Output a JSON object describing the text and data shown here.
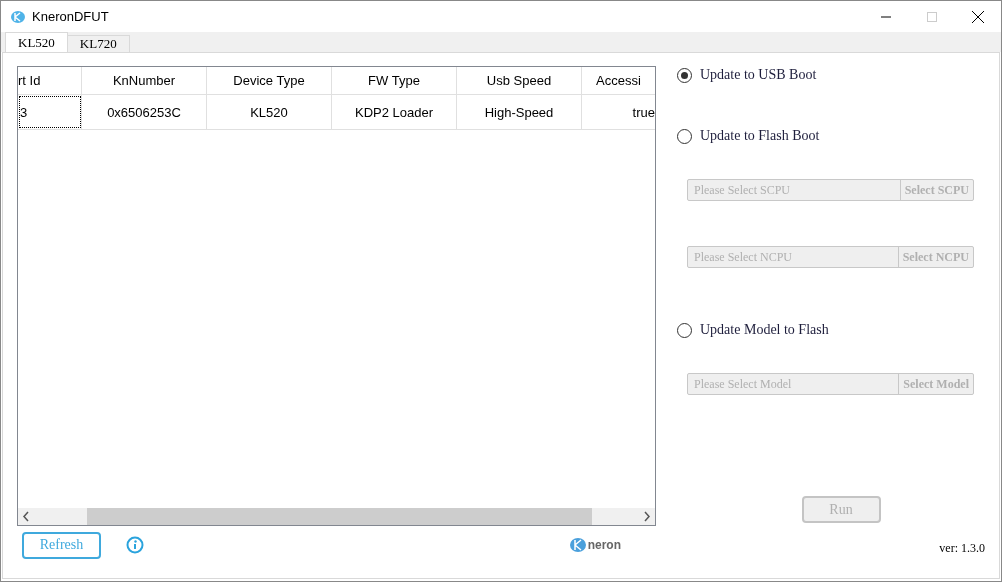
{
  "window": {
    "title": "KneronDFUT"
  },
  "tabs": [
    {
      "label": "KL520",
      "selected": true
    },
    {
      "label": "KL720",
      "selected": false
    }
  ],
  "table": {
    "columns": [
      "rt Id",
      "KnNumber",
      "Device Type",
      "FW Type",
      "Usb Speed",
      "Accessi"
    ],
    "rows": [
      {
        "cells": [
          {
            "text": "3",
            "focused": true
          },
          {
            "text": "0x6506253C",
            "focused": false
          },
          {
            "text": "KL520",
            "focused": false
          },
          {
            "text": "KDP2 Loader",
            "focused": false
          },
          {
            "text": "High-Speed",
            "focused": false
          },
          {
            "text": "true",
            "focused": false
          }
        ]
      }
    ]
  },
  "refresh_button": "Refresh",
  "logo_text": "neron",
  "options": [
    {
      "label": "Update to USB Boot",
      "selected": true
    },
    {
      "label": "Update to Flash Boot",
      "selected": false,
      "pickers": [
        {
          "placeholder": "Please Select SCPU",
          "button": "Select SCPU",
          "disabled": true
        },
        {
          "placeholder": "Please Select NCPU",
          "button": "Select NCPU",
          "disabled": true
        }
      ]
    },
    {
      "label": "Update Model to Flash",
      "selected": false,
      "pickers": [
        {
          "placeholder": "Please Select Model",
          "button": "Select Model",
          "disabled": true
        }
      ]
    }
  ],
  "run_button": {
    "label": "Run",
    "disabled": true
  },
  "version": "ver: 1.3.0"
}
